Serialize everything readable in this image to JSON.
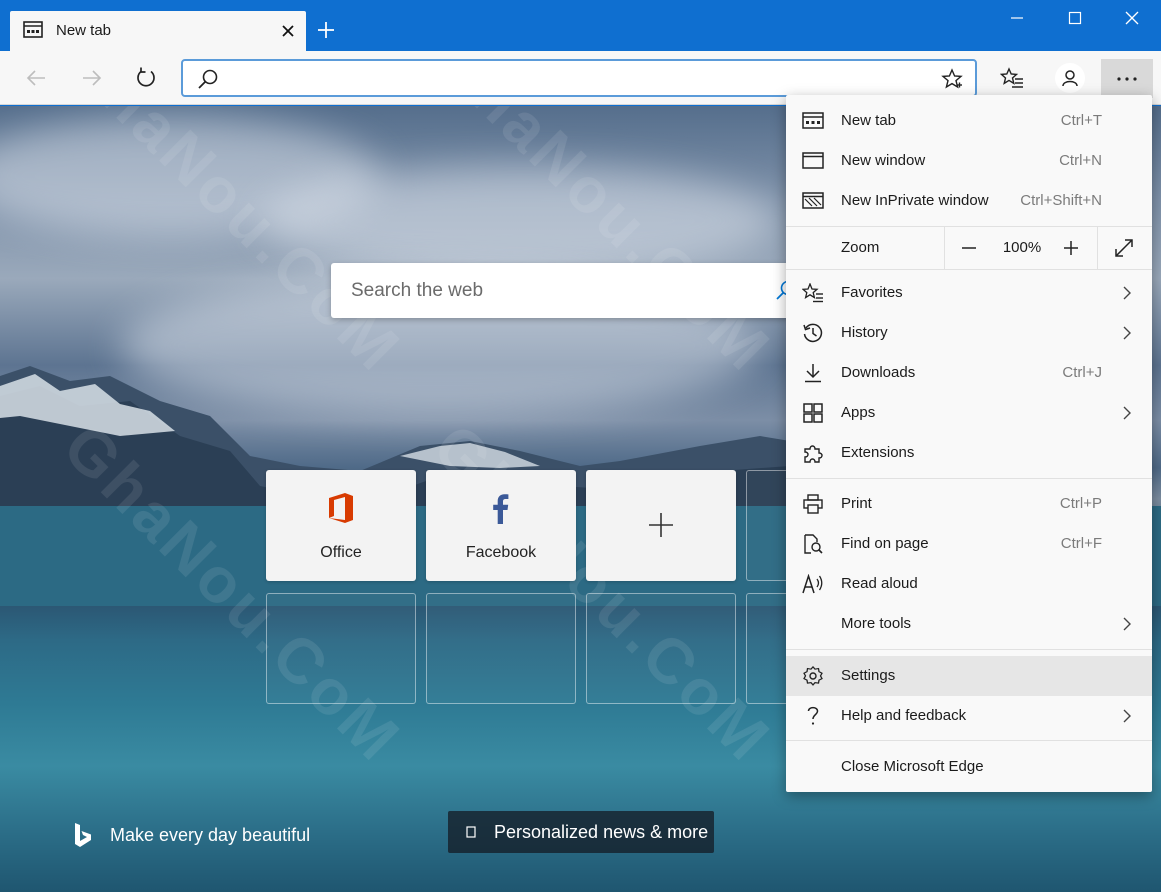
{
  "tab": {
    "title": "New tab"
  },
  "address": {
    "value": ""
  },
  "search": {
    "placeholder": "Search the web"
  },
  "tiles": [
    {
      "label": "Office",
      "icon": "office-icon",
      "color": "#d83b01"
    },
    {
      "label": "Facebook",
      "icon": "facebook-icon",
      "color": "#3b5998"
    }
  ],
  "footer": {
    "bing_text": "Make every day beautiful",
    "news_label": "Personalized news & more"
  },
  "menu": {
    "items": [
      {
        "label": "New tab",
        "shortcut": "Ctrl+T"
      },
      {
        "label": "New window",
        "shortcut": "Ctrl+N"
      },
      {
        "label": "New InPrivate window",
        "shortcut": "Ctrl+Shift+N"
      },
      {
        "label": "Favorites",
        "shortcut": ""
      },
      {
        "label": "History",
        "shortcut": ""
      },
      {
        "label": "Downloads",
        "shortcut": "Ctrl+J"
      },
      {
        "label": "Apps",
        "shortcut": ""
      },
      {
        "label": "Extensions",
        "shortcut": ""
      },
      {
        "label": "Print",
        "shortcut": "Ctrl+P"
      },
      {
        "label": "Find on page",
        "shortcut": "Ctrl+F"
      },
      {
        "label": "Read aloud",
        "shortcut": ""
      },
      {
        "label": "More tools",
        "shortcut": ""
      },
      {
        "label": "Settings",
        "shortcut": ""
      },
      {
        "label": "Help and feedback",
        "shortcut": ""
      },
      {
        "label": "Close Microsoft Edge",
        "shortcut": ""
      }
    ],
    "zoom": {
      "label": "Zoom",
      "value": "100%"
    }
  },
  "colors": {
    "titlebar": "#0f6fd0",
    "accent": "#0078d7"
  },
  "watermark": "GhaNou.CoM"
}
